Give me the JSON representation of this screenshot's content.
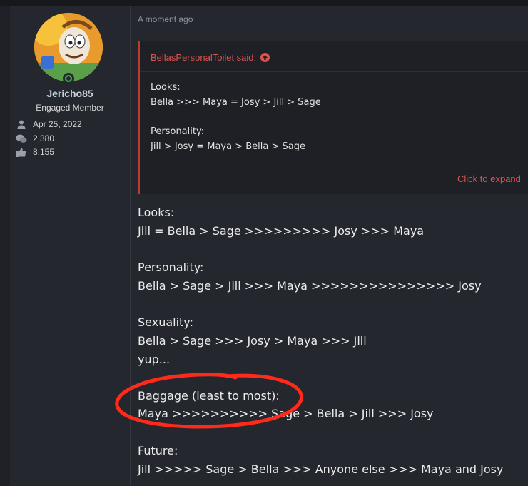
{
  "user": {
    "name": "Jericho85",
    "title": "Engaged Member",
    "joined": "Apr 25, 2022",
    "messages": "2,380",
    "reactions": "8,155",
    "status_color": "#3fb950"
  },
  "post": {
    "timestamp": "A moment ago",
    "quote": {
      "author": "BellasPersonalToilet said:",
      "icon": "arrow-up-circle-icon",
      "lines": [
        "Looks:",
        "Bella >>> Maya = Josy > Jill > Sage",
        "",
        "Personality:",
        "Jill > Josy = Maya > Bella > Sage"
      ],
      "expand_label": "Click to expand"
    },
    "body_lines": [
      "Looks:",
      "Jill = Bella > Sage >>>>>>>>> Josy >>> Maya",
      "",
      "Personality:",
      "Bella > Sage > Jill >>> Maya >>>>>>>>>>>>>>> Josy",
      "",
      "Sexuality:",
      "Bella > Sage >>> Josy > Maya >>> Jill",
      "yup...",
      "",
      "Baggage (least to most):",
      "Maya >>>>>>>>>> Sage > Bella > Jill >>> Josy",
      "",
      "Future:",
      "Jill >>>>> Sage > Bella >>> Anyone else >>> Maya and Josy"
    ]
  },
  "colors": {
    "accent_red": "#d9534f",
    "annotation_red": "#ff2a1a"
  }
}
